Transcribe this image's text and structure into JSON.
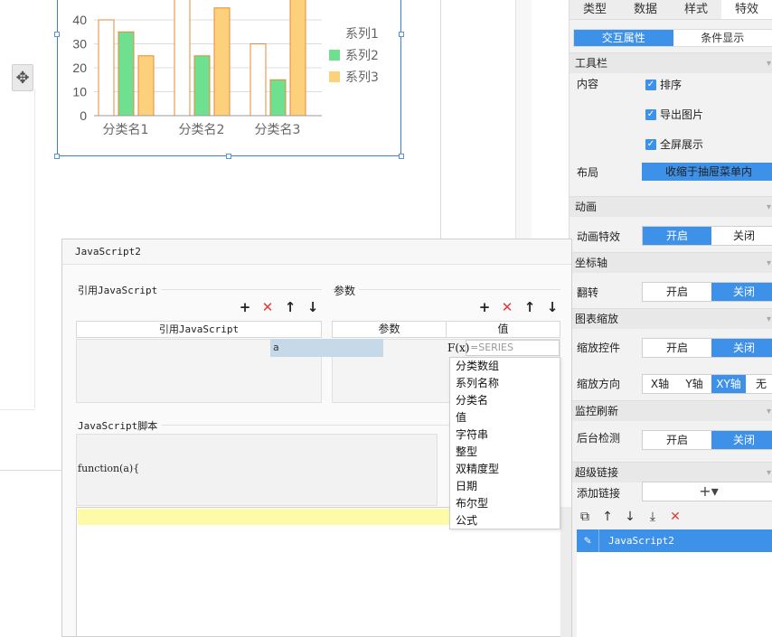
{
  "chart_data": {
    "type": "bar",
    "categories": [
      "分类名1",
      "分类名2",
      "分类名3"
    ],
    "series": [
      {
        "name": "系列1",
        "color": "#ffffff",
        "values": [
          40,
          49,
          30
        ]
      },
      {
        "name": "系列2",
        "color": "#6fe08f",
        "values": [
          35,
          25,
          15
        ]
      },
      {
        "name": "系列3",
        "color": "#fdd07c",
        "values": [
          25,
          45,
          49
        ]
      }
    ],
    "yticks": [
      "0",
      "10",
      "20",
      "30",
      "40"
    ],
    "ylim": [
      0,
      49
    ],
    "legend_position": "right",
    "bar_edge_color": "#e8893a"
  },
  "panel": {
    "tabs": [
      "类型",
      "数据",
      "样式",
      "特效"
    ],
    "subtabs": [
      "交互属性",
      "条件显示"
    ],
    "toolbar_section": "工具栏",
    "content_label": "内容",
    "checks": [
      "排序",
      "导出图片",
      "全屏展示"
    ],
    "layout_label": "布局",
    "layout_value": "收缩于抽屉菜单内",
    "animation_section": "动画",
    "animation_label": "动画特效",
    "animation_on": "开启",
    "animation_off": "关闭",
    "axis_section": "坐标轴",
    "flip_label": "翻转",
    "flip_on": "开启",
    "flip_off": "关闭",
    "zoom_section": "图表缩放",
    "zoom_ctrl_label": "缩放控件",
    "zoom_on": "开启",
    "zoom_off": "关闭",
    "zoom_dir_label": "缩放方向",
    "zoom_dirs": [
      "X轴",
      "Y轴",
      "XY轴",
      "无"
    ],
    "monitor_section": "监控刷新",
    "bg_check_label": "后台检测",
    "bg_on": "开启",
    "bg_off": "关闭",
    "hyperlink_section": "超级链接",
    "add_link_label": "添加链接",
    "add_link_plus": "+▾",
    "link_item": "JavaScript2"
  },
  "dialog": {
    "title": "JavaScript2",
    "ref_group": "引用JavaScript",
    "ref_column": "引用JavaScript",
    "param_group": "参数",
    "param_col_param": "参数",
    "param_col_value": "值",
    "param_row_name": "a",
    "script_group": "JavaScript脚本",
    "func_line": "function(a){",
    "fx_label": "F(x)",
    "fx_placeholder": "=SERIES",
    "types": [
      "分类数组",
      "系列名称",
      "分类名",
      "值",
      "字符串",
      "整型",
      "双精度型",
      "日期",
      "布尔型",
      "公式"
    ]
  },
  "colors": {
    "accent": "#3e91e8",
    "delete": "#e03a3a",
    "highlight_line": "#fffaa8"
  }
}
